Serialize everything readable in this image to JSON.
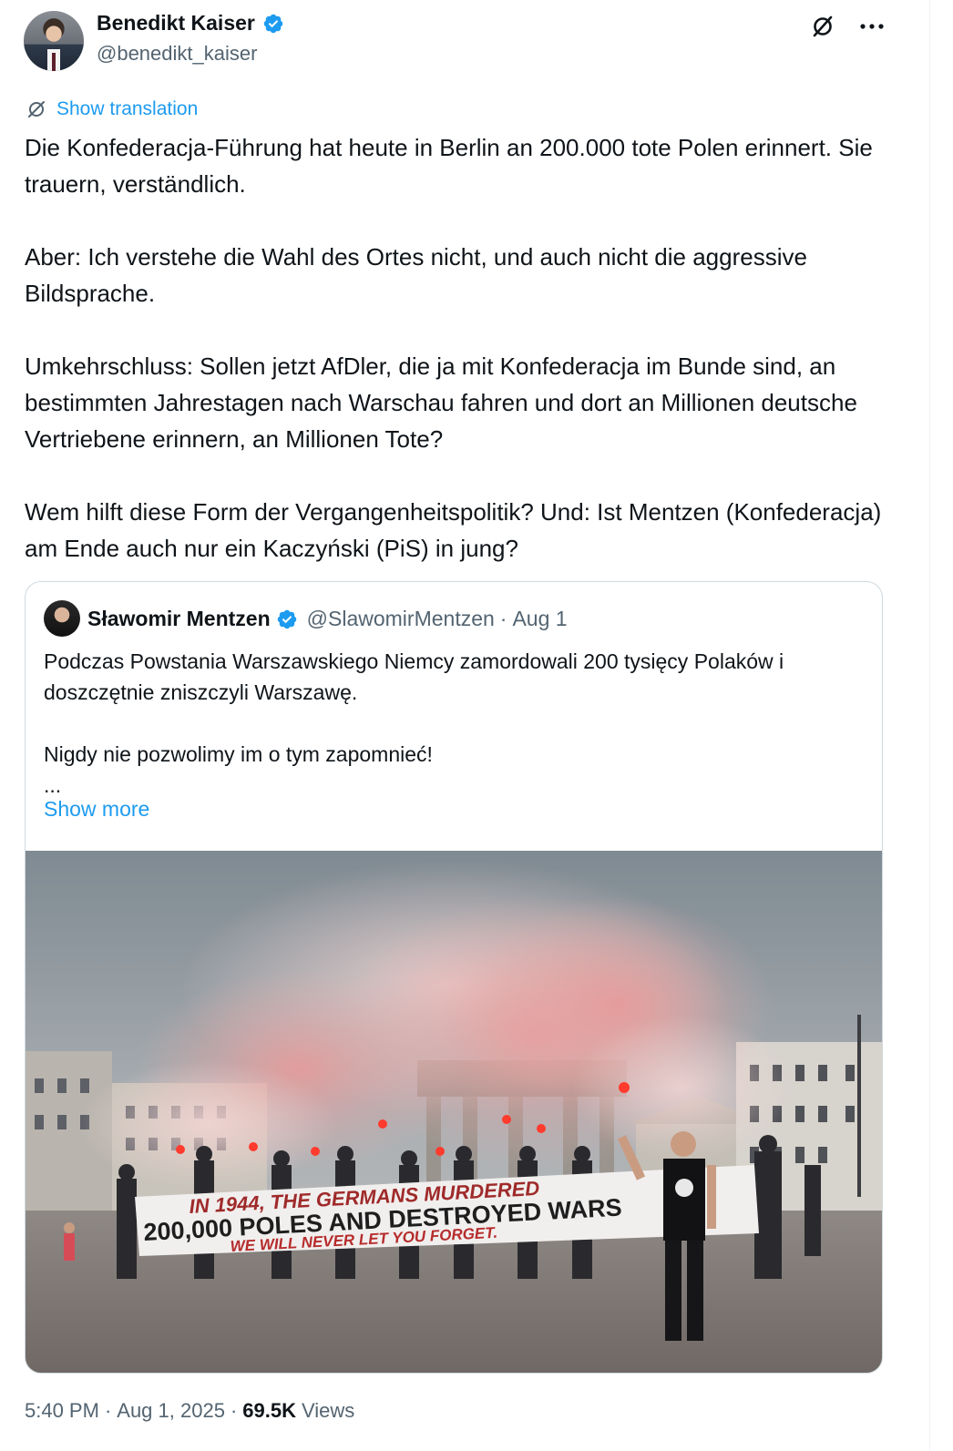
{
  "author": {
    "display_name": "Benedikt Kaiser",
    "handle": "@benedikt_kaiser",
    "verified": true
  },
  "actions": {
    "grok_icon": "grok-icon",
    "more_icon": "more-icon"
  },
  "translation": {
    "label": "Show translation"
  },
  "tweet": {
    "text": "Die Konfederacja-Führung hat heute in Berlin an 200.000 tote Polen erinnert. Sie trauern, verständlich.\n\nAber: Ich verstehe die Wahl des Ortes nicht, und auch nicht die aggressive Bildsprache.\n\nUmkehrschluss: Sollen jetzt AfDler, die ja mit Konfederacja im Bunde sind, an bestimmten Jahrestagen nach Warschau fahren und dort an Millionen deutsche Vertriebene erinnern, an Millionen Tote?\n\nWem hilft diese Form der Vergangenheitspolitik? Und: Ist Mentzen (Konfederacja) am Ende auch nur ein Kaczyński (PiS) in jung?"
  },
  "quote": {
    "display_name": "Sławomir Mentzen",
    "handle": "@SlawomirMentzen",
    "separator": "·",
    "date": "Aug 1",
    "text": "Podczas Powstania Warszawskiego Niemcy zamordowali 200 tysięcy Polaków i doszczętnie zniszczyli Warszawę.\n\nNigdy nie pozwolimy im o tym zapomnieć!\n...",
    "show_more": "Show more",
    "banner": {
      "line1": "IN 1944, THE GERMANS MURDERED",
      "line2": "200,000 POLES AND DESTROYED WARS",
      "line3": "WE WILL NEVER LET YOU FORGET."
    }
  },
  "footer": {
    "time": "5:40 PM",
    "separator": "·",
    "date": "Aug 1, 2025",
    "views_count": "69.5K",
    "views_label": "Views"
  },
  "colors": {
    "link": "#1d9bf0",
    "verified": "#1d9bf0",
    "secondary_text": "#536471",
    "text": "#0f1419"
  }
}
